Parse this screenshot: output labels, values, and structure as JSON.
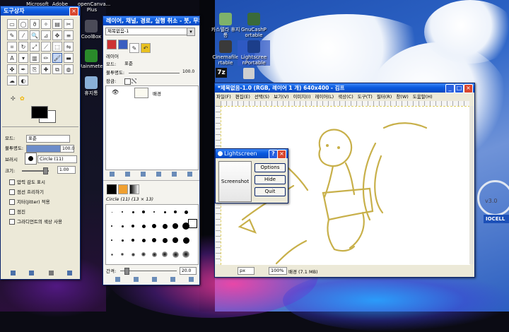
{
  "desktop": {
    "icons_left": [
      {
        "label": "Microsoft"
      },
      {
        "label": "Adobe"
      },
      {
        "label": "openCanva... Plus"
      },
      {
        "label": "CoolBox"
      },
      {
        "label": "Rainmeter"
      },
      {
        "label": "휴지통"
      }
    ],
    "icons_right": [
      {
        "label": "카스텔라 휴지통"
      },
      {
        "label": "GnuCashP ortable"
      },
      {
        "label": "Cinemafile rtable"
      },
      {
        "label": "Lightscree nPortable"
      },
      {
        "label": "7z"
      }
    ],
    "wallpaper_watermark": "IOCELL",
    "wallpaper_version": "v3.0"
  },
  "toolbox": {
    "title": "도구상자",
    "tool_icons": [
      "rect-select-icon",
      "ellipse-select-icon",
      "lasso-icon",
      "fuzzy-select-icon",
      "color-select-icon",
      "scissors-icon",
      "paths-icon",
      "color-picker-icon",
      "zoom-icon",
      "measure-icon",
      "move-icon",
      "align-icon",
      "crop-icon",
      "rotate-icon",
      "scale-icon",
      "shear-icon",
      "perspective-icon",
      "flip-icon",
      "text-icon",
      "bucket-fill-icon",
      "blend-icon",
      "pencil-icon",
      "paintbrush-icon",
      "eraser-icon",
      "airbrush-icon",
      "ink-icon",
      "clone-icon",
      "heal-icon",
      "perspective-clone-icon",
      "blur-icon",
      "smudge-icon",
      "dodge-icon"
    ],
    "options": {
      "mode_label": "모드:",
      "mode_value": "표준",
      "opacity_label": "불투명도:",
      "opacity_value": "100.0",
      "brush_label": "브러시",
      "brush_value": "Circle (11)",
      "scale_label": "크기:",
      "scale_value": "1.00",
      "checks": [
        "압력 감도 표시",
        "점선 흐리하기",
        "지터(Jitter) 적용",
        "점진",
        "그라디언트의 색상 사용"
      ]
    }
  },
  "layers": {
    "title": "레이어, 채널, 경로, 실행 취소 - 붓, 무늬, ...",
    "image_select": "제목없음-1",
    "tab_label": "레이어",
    "mode_label": "모드:",
    "mode_value": "표준",
    "opacity_label": "불투명도:",
    "opacity_value": "100.0",
    "lock_label": "잠금:",
    "layer_name": "배경",
    "brush_panel_title": "Circle (11) (13 × 13)",
    "spacing_label": "간격:",
    "spacing_value": "20.0"
  },
  "gimp_image": {
    "title": "*제목없음-1.0 (RGB, 레이어 1 개) 640x400 - 김프",
    "menu": [
      "파일(F)",
      "편집(E)",
      "선택(S)",
      "보기(V)",
      "이미지(I)",
      "레이어(L)",
      "색상(C)",
      "도구(T)",
      "필터(R)",
      "창(W)",
      "도움말(H)"
    ],
    "unit": "px",
    "zoom": "100%",
    "status": "배경 (7.1 MB)"
  },
  "lightscreen": {
    "title": "Lightscreen",
    "preview_label": "Screenshot",
    "buttons": {
      "options": "Options",
      "hide": "Hide",
      "quit": "Quit"
    }
  },
  "colors": {
    "xp_title": "#0a5ae0",
    "sketch": "#c8b04a",
    "fg": "#000000",
    "bg": "#ffffff"
  }
}
